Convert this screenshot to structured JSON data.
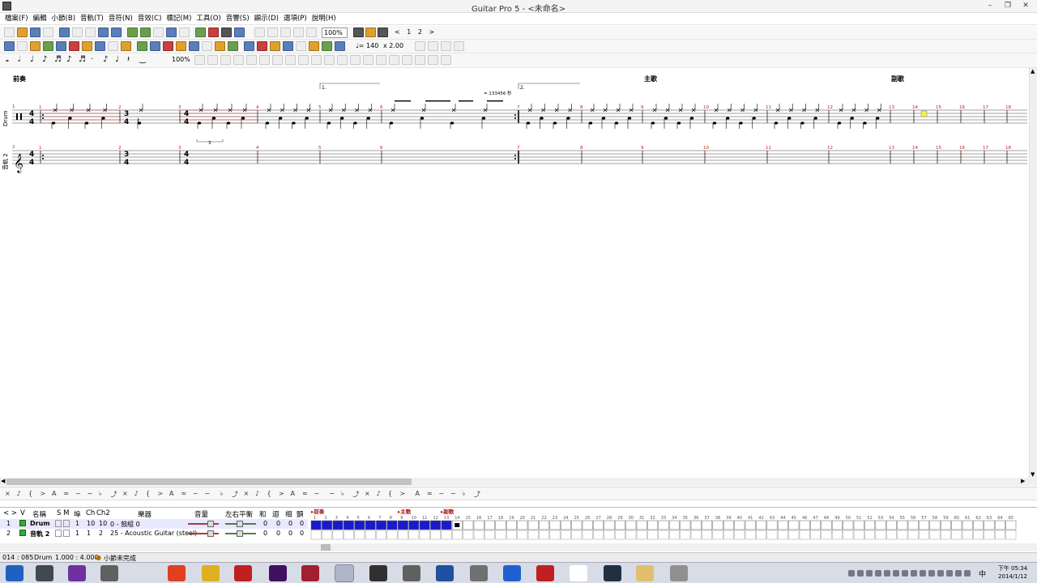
{
  "window": {
    "title": "Guitar Pro 5 - <未命名>",
    "minimize": "–",
    "restore": "❐",
    "close": "✕"
  },
  "menus": [
    "檔案(F)",
    "編輯",
    "小節(B)",
    "音軌(T)",
    "音符(N)",
    "音效(C)",
    "標記(M)",
    "工具(O)",
    "音響(S)",
    "顯示(D)",
    "選項(P)",
    "說明(H)"
  ],
  "toolbar": {
    "zoom": "100%",
    "page_nav": [
      "<",
      "1",
      "2",
      ">"
    ],
    "tempo": "♩= 140",
    "speed": "x 2.00",
    "percent": "100%"
  },
  "score": {
    "sections": [
      "前奏",
      "主歌",
      "副歌"
    ],
    "ending_1": "1.",
    "ending_2": "2.",
    "tempo_marker": "= 133456 秒",
    "triplet": "3",
    "track_labels": [
      "Drum",
      "音軌 2"
    ],
    "track_numbers": [
      "1",
      "2"
    ],
    "time_sigs": [
      {
        "top": "4",
        "bottom": "4"
      },
      {
        "top": "3",
        "bottom": "4"
      },
      {
        "top": "4",
        "bottom": "4"
      }
    ],
    "bar_numbers": [
      "1",
      "2",
      "3",
      "4",
      "5",
      "6",
      "7",
      "8",
      "9",
      "10",
      "11",
      "12",
      "13",
      "14",
      "15",
      "16",
      "17",
      "18"
    ]
  },
  "tracks": {
    "headers": [
      "V",
      "名稱",
      "S M",
      "埠",
      "Ch",
      "Ch2",
      "樂器",
      "音量",
      "左右平衡",
      "和",
      "迴",
      "相",
      "顫"
    ],
    "rows": [
      {
        "num": "1",
        "name": "Drum",
        "port": "1",
        "ch": "10",
        "ch2": "10",
        "instrument": "0 - 鼓組 0",
        "v1": "0",
        "v2": "0",
        "v3": "0",
        "v4": "0"
      },
      {
        "num": "2",
        "name": "音軌 2",
        "port": "1",
        "ch": "1",
        "ch2": "2",
        "instrument": "25 - Acoustic Guitar (steel)",
        "v1": "0",
        "v2": "0",
        "v3": "0",
        "v4": "0"
      }
    ]
  },
  "timeline": {
    "markers": [
      "前奏",
      "主歌",
      "副歌"
    ],
    "numbers": [
      "1",
      "2",
      "3",
      "4",
      "5",
      "6",
      "7",
      "8",
      "9",
      "10",
      "11",
      "12",
      "13",
      "14",
      "15",
      "16",
      "17",
      "18",
      "19",
      "20",
      "21",
      "22",
      "23",
      "24",
      "25",
      "26",
      "27",
      "28",
      "29",
      "30",
      "31",
      "32",
      "33",
      "34",
      "35",
      "36",
      "37",
      "38",
      "39",
      "40",
      "41",
      "42",
      "43",
      "44",
      "45",
      "46",
      "47",
      "48",
      "49",
      "50",
      "51",
      "52",
      "53",
      "54",
      "55",
      "56",
      "57",
      "58",
      "59",
      "60",
      "61",
      "62",
      "63",
      "64",
      "65"
    ],
    "filled_count": 13
  },
  "status": {
    "position": "014 : 085",
    "track": "Drum",
    "beat": "1.000 : 4.000",
    "message": "小節未完成"
  },
  "taskbar": {
    "ime": "中",
    "time": "下午 05:34",
    "date": "2014/1/12"
  },
  "colors": {
    "timeline_fill": "#1a1acc",
    "score_red": "#c04040",
    "selection_box": "#f0f040"
  }
}
